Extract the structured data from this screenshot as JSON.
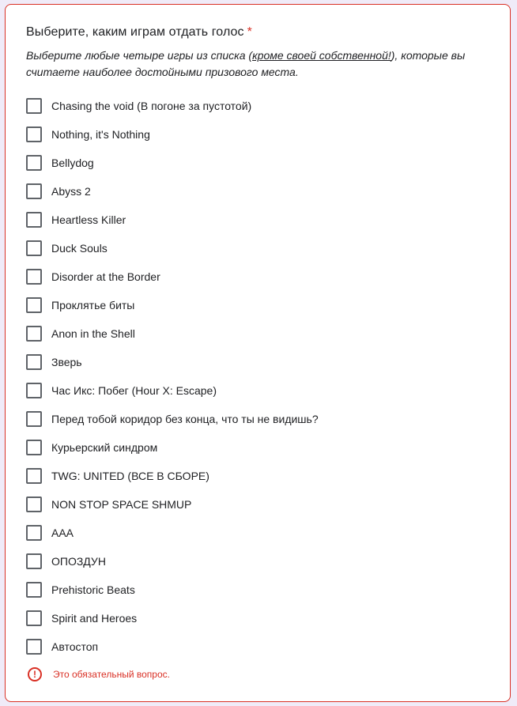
{
  "question": {
    "title": "Выберите, каким играм отдать голос",
    "required_mark": "*",
    "description_before": "Выберите любые четыре игры из списка (",
    "description_underlined": "кроме своей собственной!",
    "description_after": "), которые вы считаете наиболее достойными призового места."
  },
  "options": [
    "Chasing the void (В погоне за пустотой)",
    "Nothing, it's Nothing",
    "Bellydog",
    "Abyss 2",
    "Heartless Killer",
    "Duck Souls",
    "Disorder at the Border",
    "Проклятье биты",
    "Anon in the Shell",
    "Зверь",
    "Час Икс: Побег (Hour X: Escape)",
    "Перед тобой коридор без конца, что ты не видишь?",
    "Курьерский синдром",
    "TWG: UNITED (ВСЕ В СБОРЕ)",
    "NON STOP SPACE SHMUP",
    "ААА",
    "ОПОЗДУН",
    "Prehistoric Beats",
    "Spirit and Heroes",
    "Автостоп"
  ],
  "error": {
    "icon": "!",
    "text": "Это обязательный вопрос."
  },
  "colors": {
    "error": "#d93025",
    "checkbox_border": "#5f6368",
    "page_background": "#f0ebf8"
  }
}
